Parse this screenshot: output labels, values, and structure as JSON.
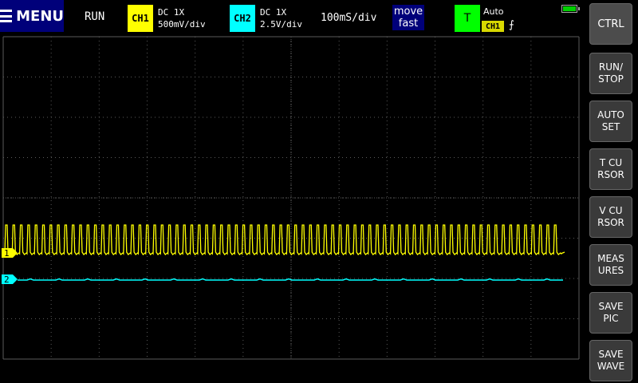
{
  "header": {
    "menu_label": "MENU",
    "run_state": "RUN",
    "ch1": {
      "tag": "CH1",
      "coupling": "DC  1X",
      "scale": "500mV/div"
    },
    "ch2": {
      "tag": "CH2",
      "coupling": "DC  1X",
      "scale": "2.5V/div"
    },
    "timebase": "100mS/div",
    "move": {
      "line1": "move",
      "line2": "fast"
    },
    "trigger": {
      "tag": "T",
      "mode": "Auto",
      "source": "CH1",
      "edge": "⨍"
    }
  },
  "markers": {
    "ch1": "1",
    "ch2": "2"
  },
  "sidebar": {
    "buttons": [
      {
        "label": "CTRL"
      },
      {
        "label": "RUN/\nSTOP"
      },
      {
        "label": "AUTO\nSET"
      },
      {
        "label": "T CU\nRSOR"
      },
      {
        "label": "V CU\nRSOR"
      },
      {
        "label": "MEAS\nURES"
      },
      {
        "label": "SAVE\nPIC"
      },
      {
        "label": "SAVE\nWAVE"
      }
    ]
  },
  "colors": {
    "ch1": "#ffff00",
    "ch2": "#00ffff",
    "grid": "#5a5a5a",
    "menu_bg": "#00007a",
    "trigger": "#00ff00"
  }
}
